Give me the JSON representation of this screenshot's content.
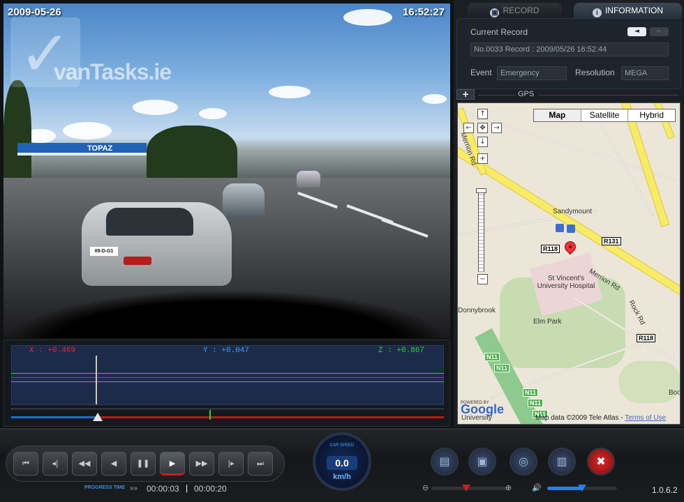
{
  "video": {
    "date": "2009-05-26",
    "time": "16:52:27",
    "watermark": "vanTasks.ie",
    "station_sign": "TOPAZ",
    "plate": "09-D-G1"
  },
  "gsensor": {
    "x_label": "X : +0.469",
    "y_label": "Y : +0.047",
    "z_label": "Z : +0.867",
    "progress": 0.2
  },
  "tabs": {
    "record": "RECORD",
    "information": "INFORMATION"
  },
  "info": {
    "current_record_label": "Current Record",
    "current_record_value": "No.0033 Record : 2009/05/26 16:52:44",
    "event_label": "Event",
    "event_value": "Emergency",
    "resolution_label": "Resolution",
    "resolution_value": "MEGA",
    "prev_arrow": "◄",
    "next_arrow": "►"
  },
  "gps": {
    "label": "GPS",
    "expand": "+"
  },
  "map": {
    "types": [
      "Map",
      "Satellite",
      "Hybrid"
    ],
    "labels": {
      "sandymount": "Sandymount",
      "st_vincents": "St Vincent's University Hospital",
      "elm_park": "Elm Park",
      "donnybrook": "Donnybrook",
      "merrion_rd": "Merrion Rd",
      "merrion_rd_left": "Merrion Rd",
      "rock_rd": "Rock Rd",
      "university": "University",
      "boo": "Boo"
    },
    "badges": [
      "R131",
      "R118",
      "R118"
    ],
    "green_badges": [
      "N11",
      "N11",
      "N11",
      "N11",
      "N11"
    ],
    "powered": "POWERED BY",
    "google": "Google",
    "mapdata": "Map data ©2009 Tele Atlas - ",
    "terms": "Terms of Use"
  },
  "controls": {
    "progress_label": "PROGRESS TIME",
    "current_time": "00:00:03",
    "total_time": "00:00:20",
    "speed_label": "CAR SPEED",
    "speed_value": "0.0",
    "speed_unit": "km/h",
    "version": "1.0.6.2",
    "zoom_minus": "⊖",
    "zoom_plus": "⊕"
  }
}
